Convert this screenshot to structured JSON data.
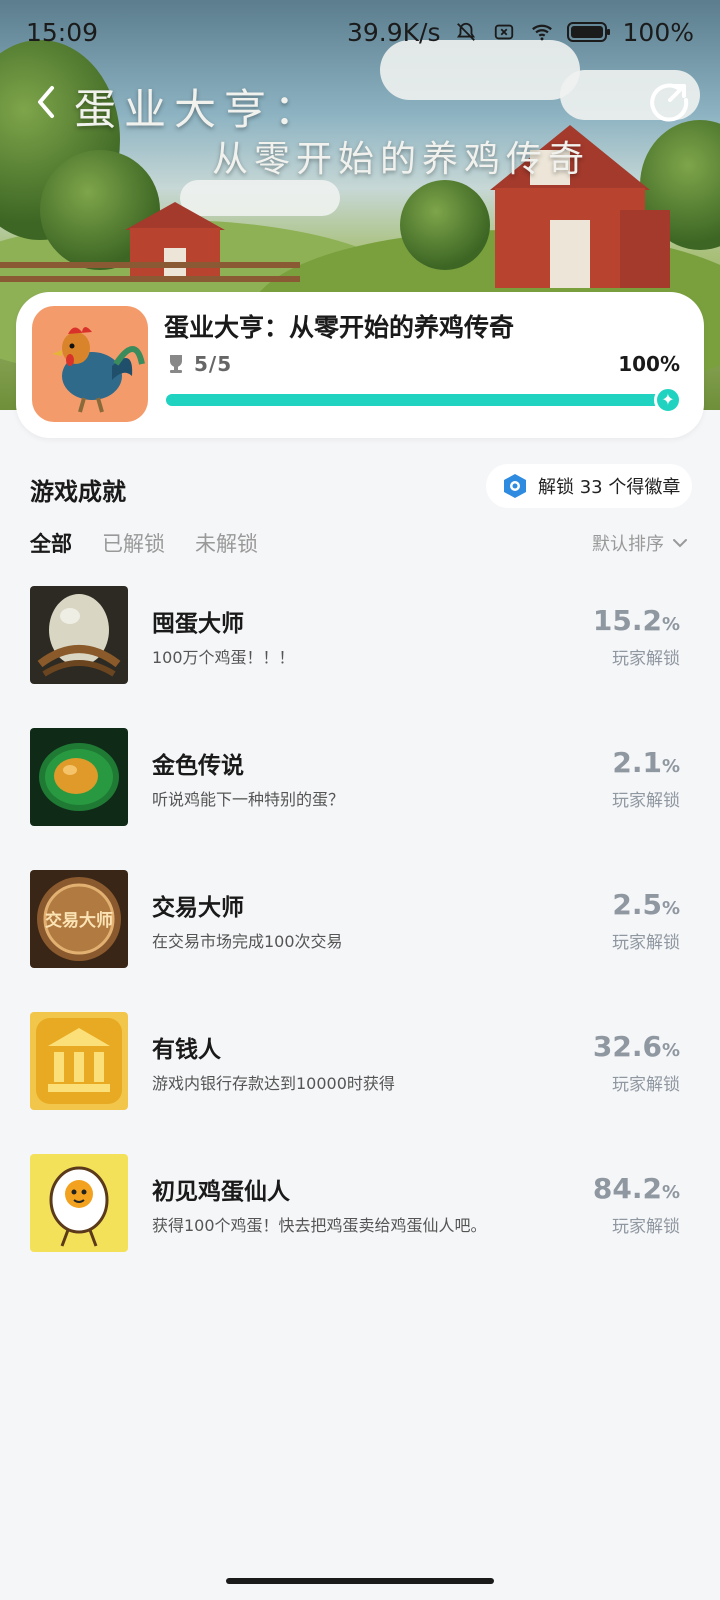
{
  "status_bar": {
    "time": "15:09",
    "network_speed": "39.9K/s",
    "battery": "100%",
    "icons": [
      "bell-muted-icon",
      "no-sim-icon",
      "wifi-icon",
      "battery-icon"
    ]
  },
  "hero": {
    "title_line1": "蛋业大亨：",
    "title_line2": "从零开始的养鸡传奇"
  },
  "game": {
    "name": "蛋业大亨：从零开始的养鸡传奇",
    "trophies": "5/5",
    "progress_label": "100%",
    "progress": 1.0,
    "icon": "rooster-icon"
  },
  "achievements_section": {
    "title": "游戏成就",
    "badge_text": "解锁 33 个得徽章"
  },
  "tabs": [
    {
      "label": "全部",
      "active": true
    },
    {
      "label": "已解锁",
      "active": false
    },
    {
      "label": "未解锁",
      "active": false
    }
  ],
  "sort_label": "默认排序",
  "achievements": [
    {
      "name": "囤蛋大师",
      "desc": "100万个鸡蛋！！！",
      "pct": "15.2",
      "unit": "%",
      "sub": "玩家解锁",
      "thumb": "egg-chains"
    },
    {
      "name": "金色传说",
      "desc": "听说鸡能下一种特别的蛋？",
      "pct": "2.1",
      "unit": "%",
      "sub": "玩家解锁",
      "thumb": "golden-egg"
    },
    {
      "name": "交易大师",
      "desc": "在交易市场完成100次交易",
      "pct": "2.5",
      "unit": "%",
      "sub": "玩家解锁",
      "thumb": "coin-seal",
      "thumb_text": "交易大师"
    },
    {
      "name": "有钱人",
      "desc": "游戏内银行存款达到10000时获得",
      "pct": "32.6",
      "unit": "%",
      "sub": "玩家解锁",
      "thumb": "bank-coin"
    },
    {
      "name": "初见鸡蛋仙人",
      "desc": "获得100个鸡蛋！快去把鸡蛋卖给鸡蛋仙人吧。",
      "pct": "84.2",
      "unit": "%",
      "sub": "玩家解锁",
      "thumb": "egg-character"
    }
  ],
  "colors": {
    "accent": "#1fd3c0",
    "pct_gray": "#8f97a0",
    "background": "#f5f6f8"
  }
}
